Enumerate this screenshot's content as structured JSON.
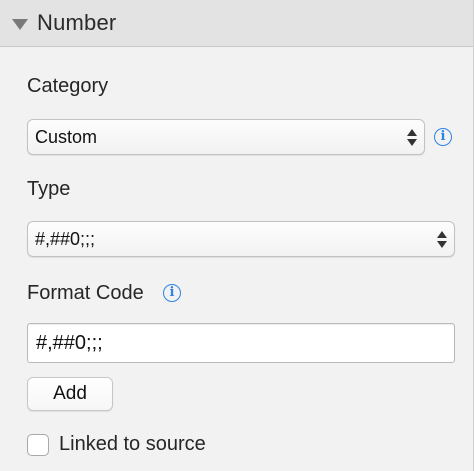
{
  "section": {
    "title": "Number",
    "disclosure_icon": "triangle-down-icon"
  },
  "category": {
    "label": "Category",
    "selected": "Custom",
    "info_icon": "info-icon",
    "accent_color": "#2d83e6"
  },
  "type": {
    "label": "Type",
    "selected": "#,##0;;;"
  },
  "format_code": {
    "label": "Format Code",
    "value": "#,##0;;;",
    "info_icon": "info-icon"
  },
  "add_button": {
    "label": "Add"
  },
  "linked_to_source": {
    "label": "Linked to source",
    "checked": false
  }
}
